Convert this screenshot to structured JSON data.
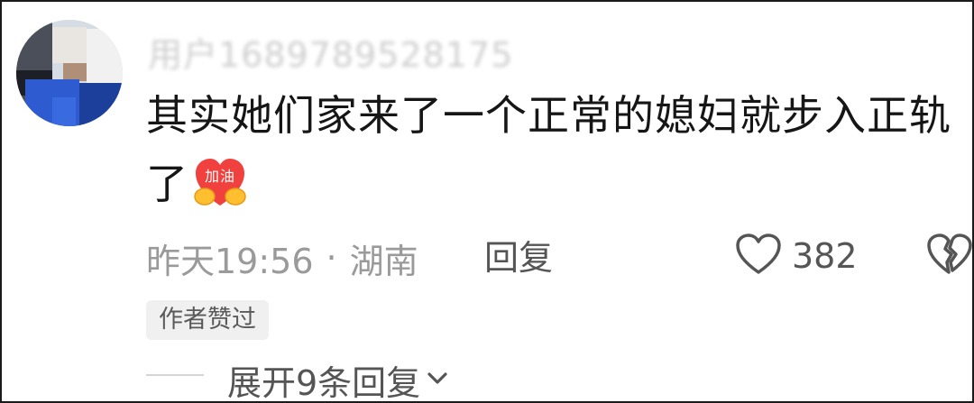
{
  "comment": {
    "username": "用户1689789528175",
    "text": "其实她们家来了一个正常的媳妇就步入正轨了",
    "emoji": {
      "name": "jiayou-sticker-icon",
      "label": "加油"
    },
    "time": "昨天19:56",
    "separator": "·",
    "location": "湖南",
    "reply_label": "回复",
    "like_count": "382",
    "author_badge": "作者赞过",
    "expand_label": "展开9条回复"
  },
  "icons": {
    "like": "heart-outline-icon",
    "dislike": "broken-heart-icon",
    "expand": "chevron-down-icon"
  },
  "colors": {
    "text": "#161616",
    "meta": "#9a9a9a",
    "action": "#555555",
    "badge_bg": "#f0f0f0",
    "emoji_red": "#f0413f",
    "emoji_yellow": "#ffbf2e"
  }
}
